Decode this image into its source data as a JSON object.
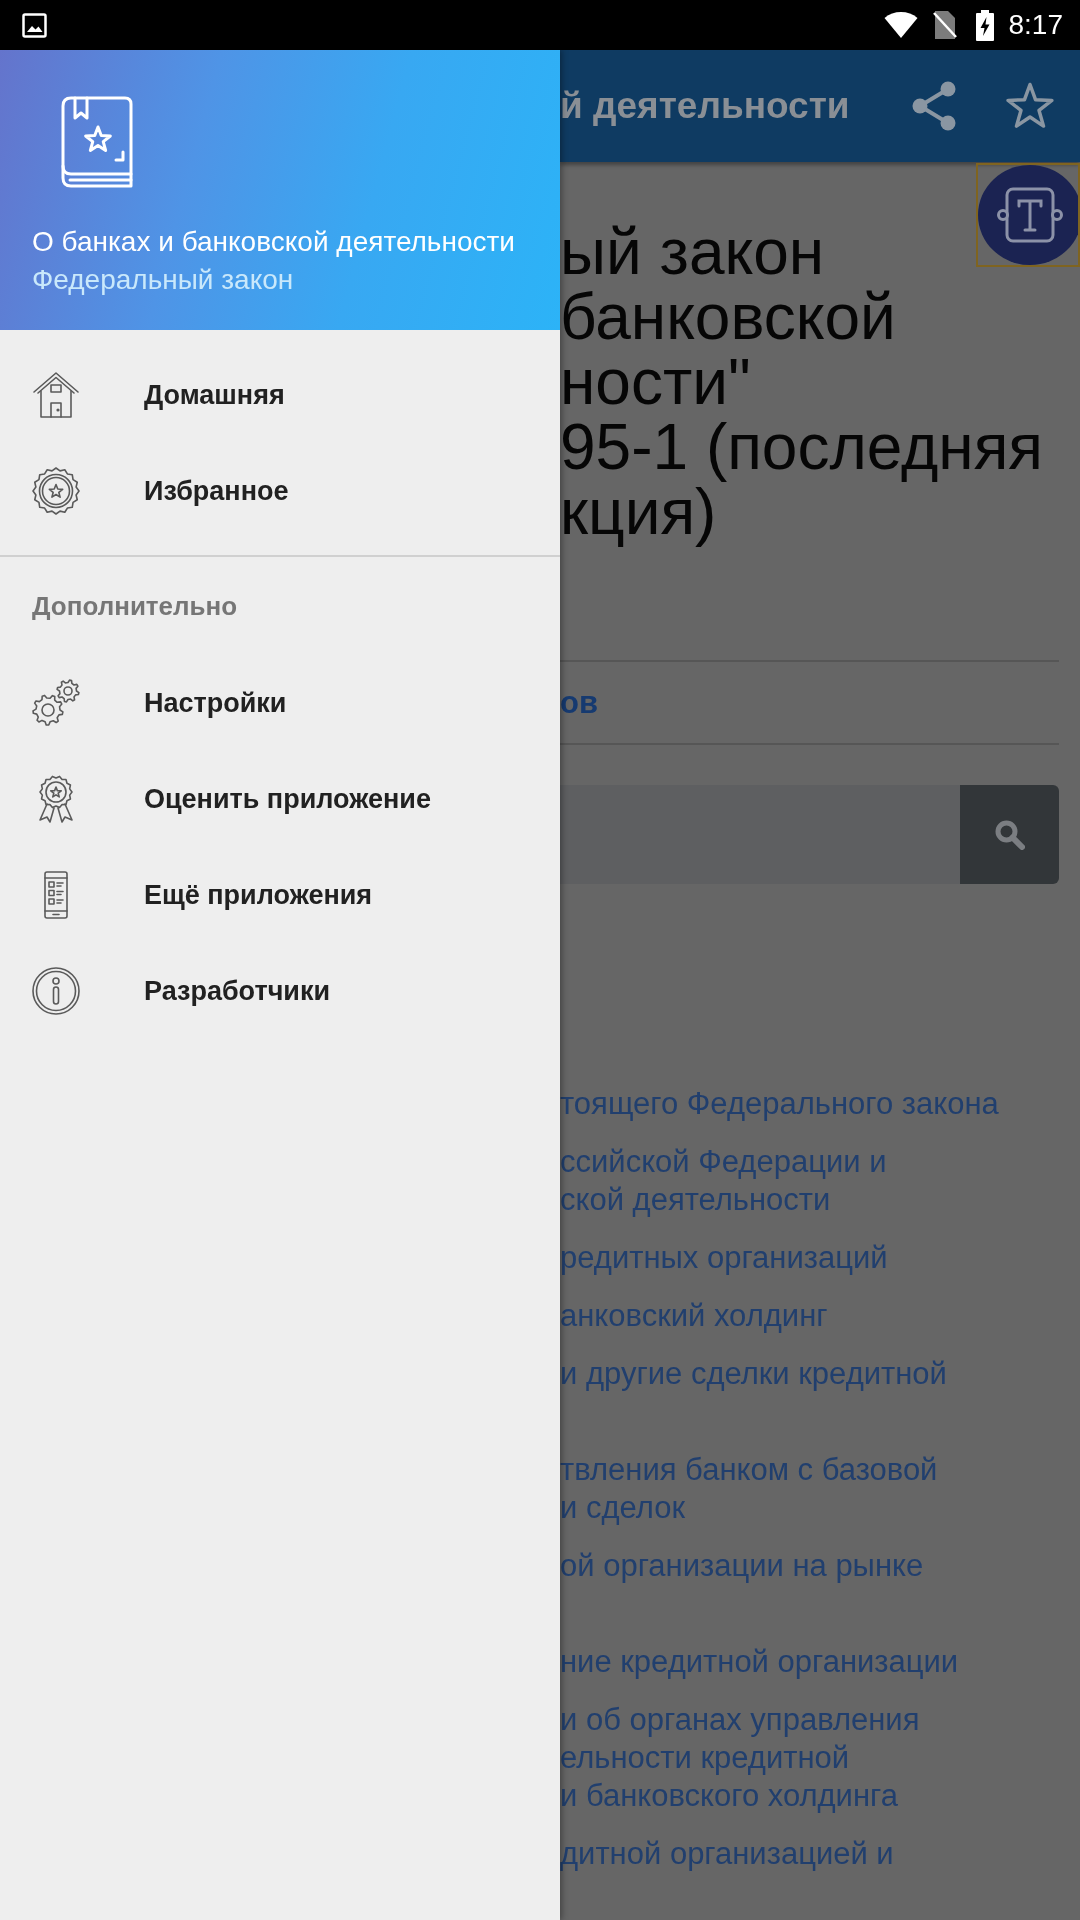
{
  "status_bar": {
    "time": "8:17"
  },
  "background_screen": {
    "app_bar": {
      "title": "й деятельности"
    },
    "document_title_lines": [
      "ый закон",
      "банковской",
      "ности\"",
      "95-1 (последняя",
      "кция)"
    ],
    "section_link": "ов",
    "contents_links": [
      {
        "lines": [
          "тоящего Федерального закона"
        ],
        "second_line_hidden": false
      },
      {
        "lines": [
          "ссийской Федерации и",
          "ской деятельности"
        ],
        "second_line_hidden": false
      },
      {
        "lines": [
          "редитных организаций"
        ],
        "second_line_hidden": false
      },
      {
        "lines": [
          "анковский холдинг"
        ],
        "second_line_hidden": false
      },
      {
        "lines": [
          "и другие сделки кредитной"
        ],
        "second_line_hidden": true
      },
      {
        "lines": [
          "твления банком с базовой",
          "и сделок"
        ],
        "second_line_hidden": false
      },
      {
        "lines": [
          "ой организации на рынке"
        ],
        "second_line_hidden": true
      },
      {
        "lines": [
          "ние кредитной организации"
        ],
        "second_line_hidden": false
      },
      {
        "lines": [
          "и об органах управления",
          "ельности кредитной",
          "и банковского холдинга"
        ],
        "second_line_hidden": false
      },
      {
        "lines": [
          "дитной организацией и"
        ],
        "second_line_hidden": false
      }
    ]
  },
  "drawer": {
    "header": {
      "title": "О банках и банковской деятельности",
      "subtitle": "Федеральный закон"
    },
    "sections": [
      {
        "items": [
          {
            "label": "Домашняя"
          },
          {
            "label": "Избранное"
          }
        ]
      },
      {
        "title": "Дополнительно",
        "items": [
          {
            "label": "Настройки"
          },
          {
            "label": "Оценить приложение"
          },
          {
            "label": "Ещё приложения"
          },
          {
            "label": "Разработчики"
          }
        ]
      }
    ]
  }
}
